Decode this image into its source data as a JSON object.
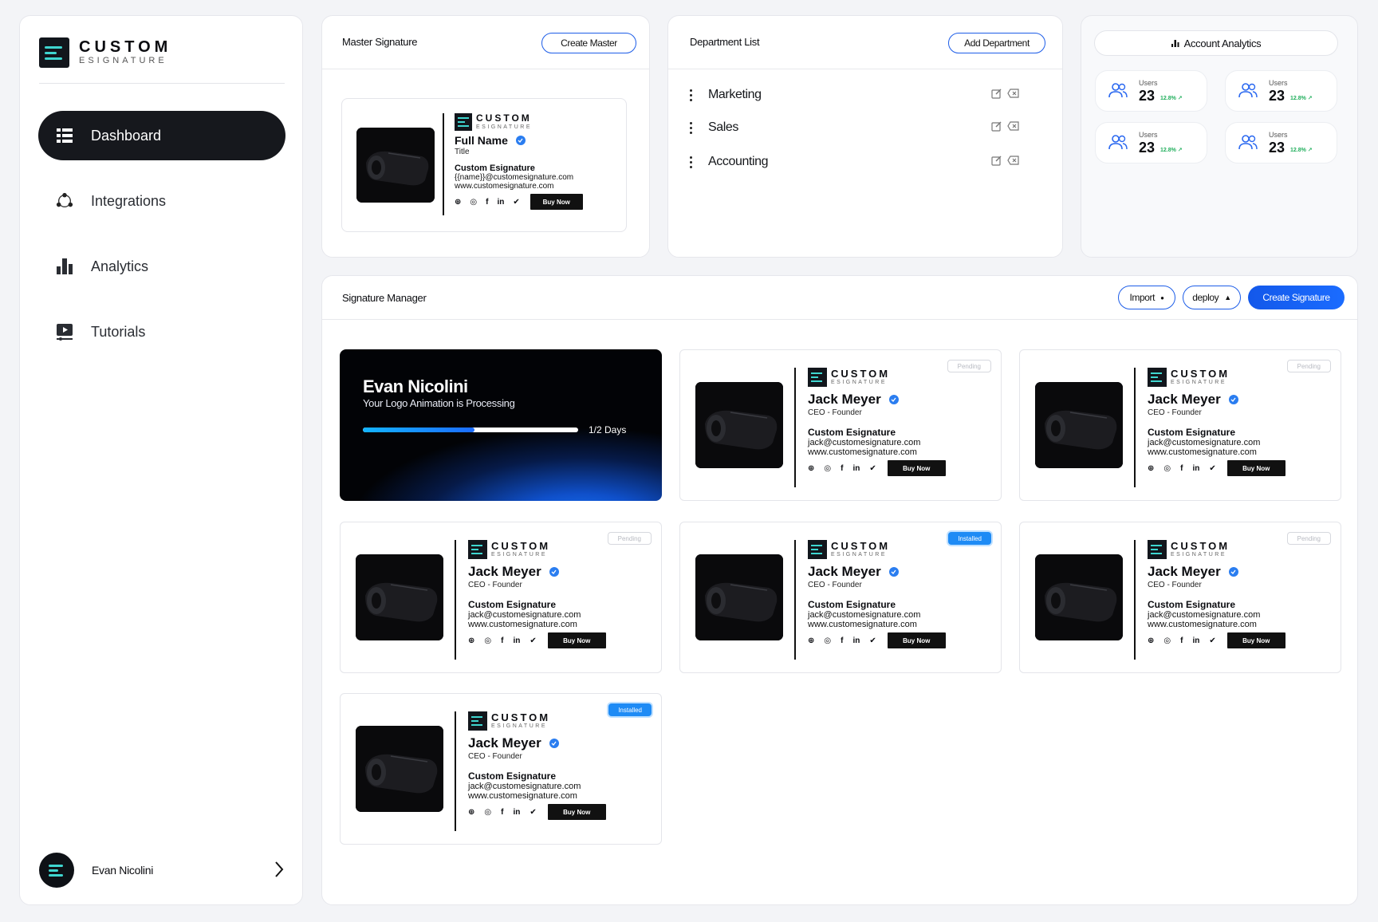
{
  "brand": {
    "name": "CUSTOM",
    "sub": "ESIGNATURE"
  },
  "sidebar": {
    "items": [
      {
        "label": "Dashboard",
        "icon": "dashboard-icon",
        "active": true
      },
      {
        "label": "Integrations",
        "icon": "integrations-icon"
      },
      {
        "label": "Analytics",
        "icon": "bar-chart-icon"
      },
      {
        "label": "Tutorials",
        "icon": "video-icon"
      }
    ],
    "user": {
      "name": "Evan Nicolini"
    }
  },
  "master": {
    "title": "Master Signature",
    "create_label": "Create Master",
    "card": {
      "name": "Full Name",
      "title": "Title",
      "company": "Custom Esignature",
      "email": "{{name}}@customesignature.com",
      "website": "www.customesignature.com",
      "buy_label": "Buy Now"
    }
  },
  "departments": {
    "title": "Department List",
    "add_label": "Add Department",
    "items": [
      "Marketing",
      "Sales",
      "Accounting"
    ]
  },
  "analytics": {
    "title": "Account Analytics",
    "stats": [
      {
        "label": "Users",
        "value": "23",
        "change": "12.8%"
      },
      {
        "label": "Users",
        "value": "23",
        "change": "12.8%"
      },
      {
        "label": "Users",
        "value": "23",
        "change": "12.8%"
      },
      {
        "label": "Users",
        "value": "23",
        "change": "12.8%"
      }
    ]
  },
  "manager": {
    "title": "Signature Manager",
    "import_label": "Import",
    "deploy_label": "deploy",
    "create_label": "Create Signature",
    "processing": {
      "name": "Evan Nicolini",
      "message": "Your Logo Animation is Processing",
      "progress": 0.52,
      "days": "1/2 Days"
    },
    "signatures": [
      {
        "name": "Jack Meyer",
        "title": "CEO - Founder",
        "company": "Custom Esignature",
        "email": "jack@customesignature.com",
        "website": "www.customesignature.com",
        "buy_label": "Buy Now",
        "status": "Pending"
      },
      {
        "name": "Jack Meyer",
        "title": "CEO - Founder",
        "company": "Custom Esignature",
        "email": "jack@customesignature.com",
        "website": "www.customesignature.com",
        "buy_label": "Buy Now",
        "status": "Pending"
      },
      {
        "name": "Jack Meyer",
        "title": "CEO - Founder",
        "company": "Custom Esignature",
        "email": "jack@customesignature.com",
        "website": "www.customesignature.com",
        "buy_label": "Buy Now",
        "status": "Pending"
      },
      {
        "name": "Jack Meyer",
        "title": "CEO - Founder",
        "company": "Custom Esignature",
        "email": "jack@customesignature.com",
        "website": "www.customesignature.com",
        "buy_label": "Buy Now",
        "status": "Installed"
      },
      {
        "name": "Jack Meyer",
        "title": "CEO - Founder",
        "company": "Custom Esignature",
        "email": "jack@customesignature.com",
        "website": "www.customesignature.com",
        "buy_label": "Buy Now",
        "status": "Pending"
      },
      {
        "name": "Jack Meyer",
        "title": "CEO - Founder",
        "company": "Custom Esignature",
        "email": "jack@customesignature.com",
        "website": "www.customesignature.com",
        "buy_label": "Buy Now",
        "status": "Installed"
      }
    ]
  },
  "colors": {
    "accent": "#1d5de8",
    "cta": "#1565f5",
    "teal": "#3fd6d0",
    "positive": "#1fae5b"
  }
}
